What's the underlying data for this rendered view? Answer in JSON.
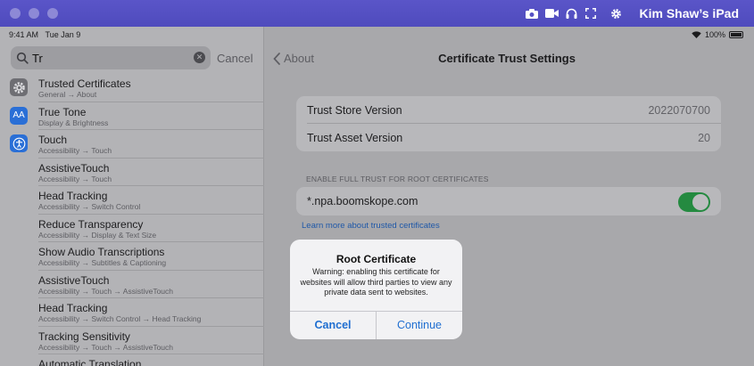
{
  "window": {
    "title": "Kim Shaw’s iPad",
    "toolbar_icons": [
      "camera-icon",
      "video-icon",
      "headphones-icon",
      "fullscreen-icon",
      "gear-icon"
    ]
  },
  "status_bar": {
    "time": "9:41 AM",
    "date": "Tue Jan 9",
    "battery": "100%"
  },
  "search": {
    "value": "Tr",
    "cancel_label": "Cancel"
  },
  "results": [
    {
      "title": "Trusted Certificates",
      "path": "General → About",
      "icon": "gear-icon",
      "icon_color": "#6e6e73"
    },
    {
      "title": "True Tone",
      "path": "Display & Brightness",
      "icon": "display-aa-icon",
      "icon_color": "#2a6fd6"
    },
    {
      "title": "Touch",
      "path": "Accessibility → Touch",
      "icon": "accessibility-icon",
      "icon_color": "#2a6fd6"
    },
    {
      "title": "AssistiveTouch",
      "path": "Accessibility → Touch"
    },
    {
      "title": "Head Tracking",
      "path": "Accessibility → Switch Control"
    },
    {
      "title": "Reduce Transparency",
      "path": "Accessibility → Display & Text Size"
    },
    {
      "title": "Show Audio Transcriptions",
      "path": "Accessibility → Subtitles & Captioning"
    },
    {
      "title": "AssistiveTouch",
      "path": "Accessibility → Touch → AssistiveTouch"
    },
    {
      "title": "Head Tracking",
      "path": "Accessibility → Switch Control → Head Tracking"
    },
    {
      "title": "Tracking Sensitivity",
      "path": "Accessibility → Touch → AssistiveTouch"
    },
    {
      "title": "Automatic Translation",
      "path": ""
    }
  ],
  "detail": {
    "back_label": "About",
    "title": "Certificate Trust Settings",
    "info_rows": [
      {
        "label": "Trust Store Version",
        "value": "2022070700"
      },
      {
        "label": "Trust Asset Version",
        "value": "20"
      }
    ],
    "section_header": "ENABLE FULL TRUST FOR ROOT CERTIFICATES",
    "certificate": {
      "name": "*.npa.boomskope.com",
      "enabled": true
    },
    "learn_more": "Learn more about trusted certificates"
  },
  "alert": {
    "title": "Root Certificate",
    "message": "Warning: enabling this certificate for websites will allow third parties to view any private data sent to websites.",
    "cancel_label": "Cancel",
    "continue_label": "Continue"
  }
}
